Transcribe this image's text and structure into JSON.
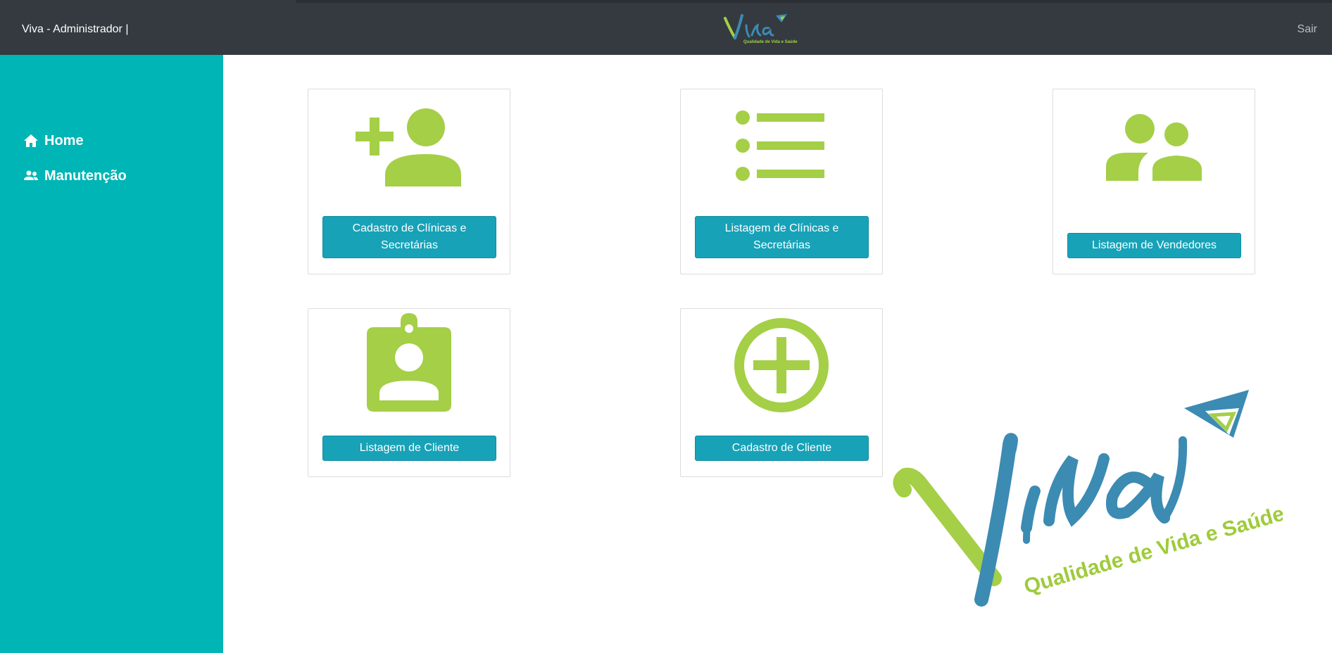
{
  "header": {
    "title": "Viva - Administrador |",
    "logout_label": "Sair",
    "logo": {
      "name": "viva-logo",
      "text": "Viva",
      "tagline": "Qualidade de Vida e Saúde"
    }
  },
  "sidebar": {
    "items": [
      {
        "icon": "home-icon",
        "label": "Home"
      },
      {
        "icon": "users-icon",
        "label": "Manutenção"
      }
    ]
  },
  "cards": [
    {
      "icon": "add-user-icon",
      "button_label": "Cadastro de Clínicas e Secretárias"
    },
    {
      "icon": "list-icon",
      "button_label": "Listagem de Clínicas e Secretárias"
    },
    {
      "icon": "group-icon",
      "button_label": "Listagem de Vendedores"
    },
    {
      "icon": "badge-icon",
      "button_label": "Listagem de Cliente"
    },
    {
      "icon": "plus-circle-icon",
      "button_label": "Cadastro de Cliente"
    }
  ],
  "watermark": {
    "text": "Viva",
    "tagline": "Qualidade de Vida e Saúde"
  },
  "colors": {
    "topbar": "#343a40",
    "sidebar": "#00b5b5",
    "icon_green": "#a4cf47",
    "button": "#17a2b8",
    "logo_blue": "#3c8bb3"
  }
}
